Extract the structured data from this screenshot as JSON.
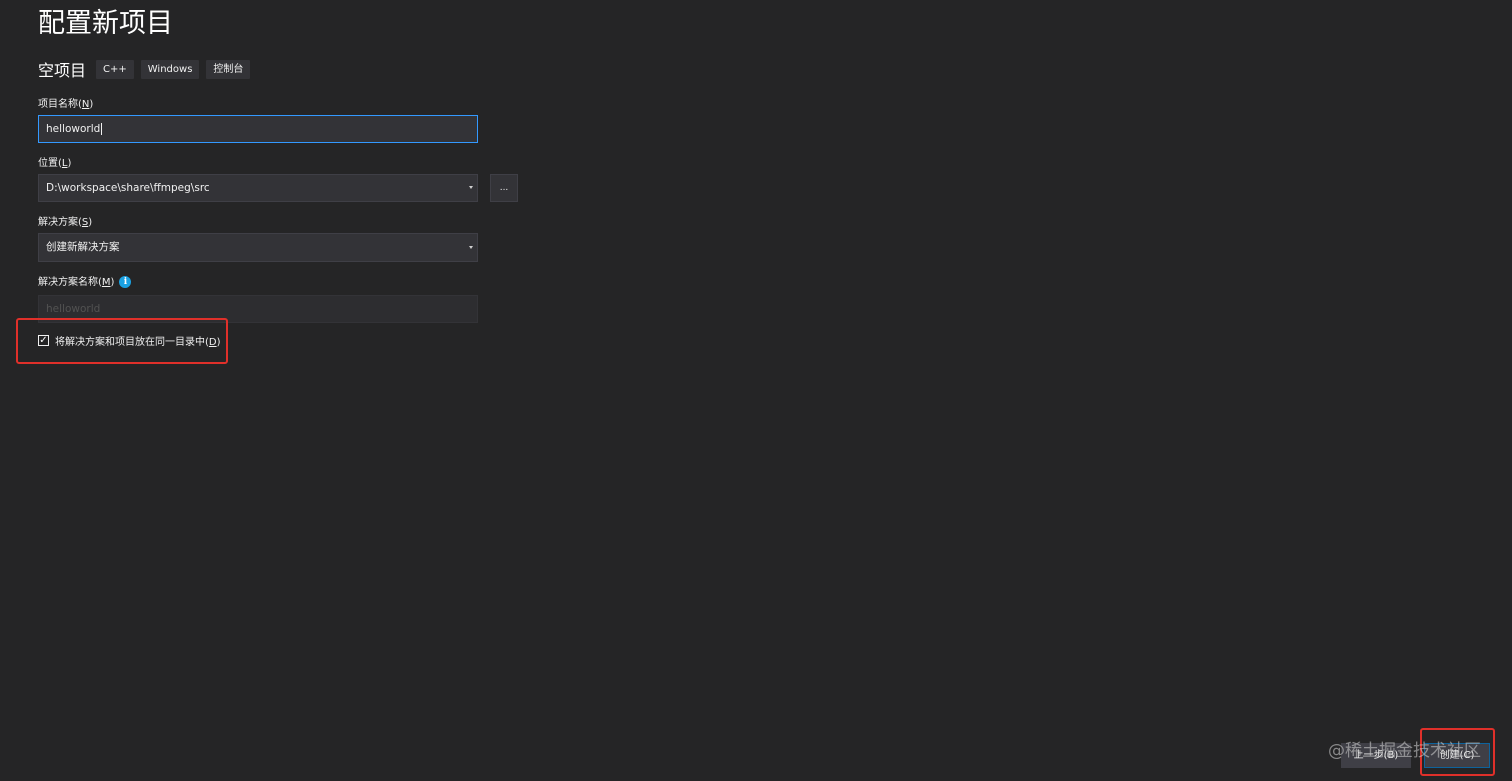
{
  "page_title": "配置新项目",
  "template": {
    "name": "空项目",
    "tags": [
      "C++",
      "Windows",
      "控制台"
    ]
  },
  "project_name": {
    "label": "项目名称",
    "mnemonic": "N",
    "value": "helloworld"
  },
  "location": {
    "label": "位置",
    "mnemonic": "L",
    "value": "D:\\workspace\\share\\ffmpeg\\src",
    "browse_label": "..."
  },
  "solution": {
    "label": "解决方案",
    "mnemonic": "S",
    "value": "创建新解决方案"
  },
  "solution_name": {
    "label": "解决方案名称",
    "mnemonic": "M",
    "placeholder": "helloworld",
    "info_icon": "info-icon",
    "info_glyph": "i"
  },
  "same_directory": {
    "checked": true,
    "check_glyph": "✓",
    "label": "将解决方案和项目放在同一目录中",
    "mnemonic": "D"
  },
  "buttons": {
    "back": "上一步(B)",
    "create": "创建(C)"
  },
  "watermark": "@稀土掘金技术社区",
  "colors": {
    "background": "#252526",
    "input_background": "#333337",
    "focus_border": "#3399ff",
    "highlight_red": "#e0302a",
    "info_blue": "#1ba1e2"
  }
}
